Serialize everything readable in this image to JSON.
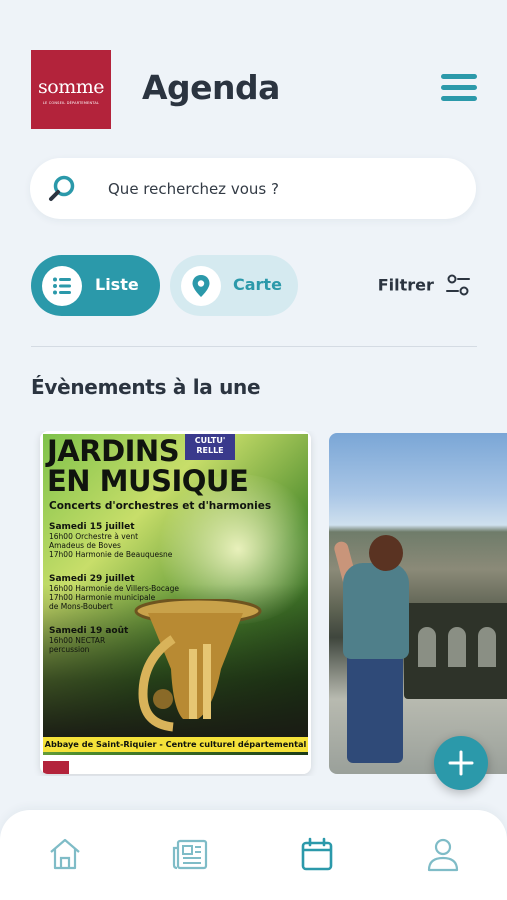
{
  "header": {
    "logo_brand": "somme",
    "logo_tagline": "LE CONSEIL DÉPARTEMENTAL",
    "title": "Agenda",
    "menu_icon": "hamburger-menu-icon"
  },
  "search": {
    "placeholder": "Que recherchez vous ?",
    "icon": "search-icon"
  },
  "view_toggle": {
    "list_label": "Liste",
    "map_label": "Carte",
    "filter_label": "Filtrer"
  },
  "section": {
    "title": "Évènements à la une"
  },
  "cards": [
    {
      "poster_title_line1": "JARDINS",
      "poster_title_line2": "EN MUSIQUE",
      "poster_badge": "CULTU' RELLE",
      "poster_subtitle": "Concerts d'orchestres et d'harmonies",
      "events": [
        {
          "date": "Samedi 15 juillet",
          "line1": "16h00 Orchestre à vent",
          "line2": "Amadeus de Boves",
          "line3": "17h00 Harmonie de Beauquesne"
        },
        {
          "date": "Samedi 29 juillet",
          "line1": "16h00 Harmonie de Villers-Bocage",
          "line2": "17h00 Harmonie municipale",
          "line3": "de Mons-Boubert"
        },
        {
          "date": "Samedi 19 août",
          "line1": "16h00 NECTAR",
          "line2": "percussion",
          "line3": ""
        }
      ],
      "poster_band": "Abbaye de Saint-Riquier - Centre culturel départemental"
    },
    {
      "image": "person-on-terrace-photo"
    }
  ],
  "fab": {
    "icon": "plus-icon"
  },
  "bottom_nav": [
    {
      "icon": "home-icon"
    },
    {
      "icon": "newspaper-icon"
    },
    {
      "icon": "calendar-icon"
    },
    {
      "icon": "user-icon"
    }
  ],
  "colors": {
    "accent": "#2b99aa",
    "accent_light": "#d5eaf0",
    "brand_red": "#b3233b",
    "background": "#eef3f8",
    "text": "#2b3440"
  }
}
